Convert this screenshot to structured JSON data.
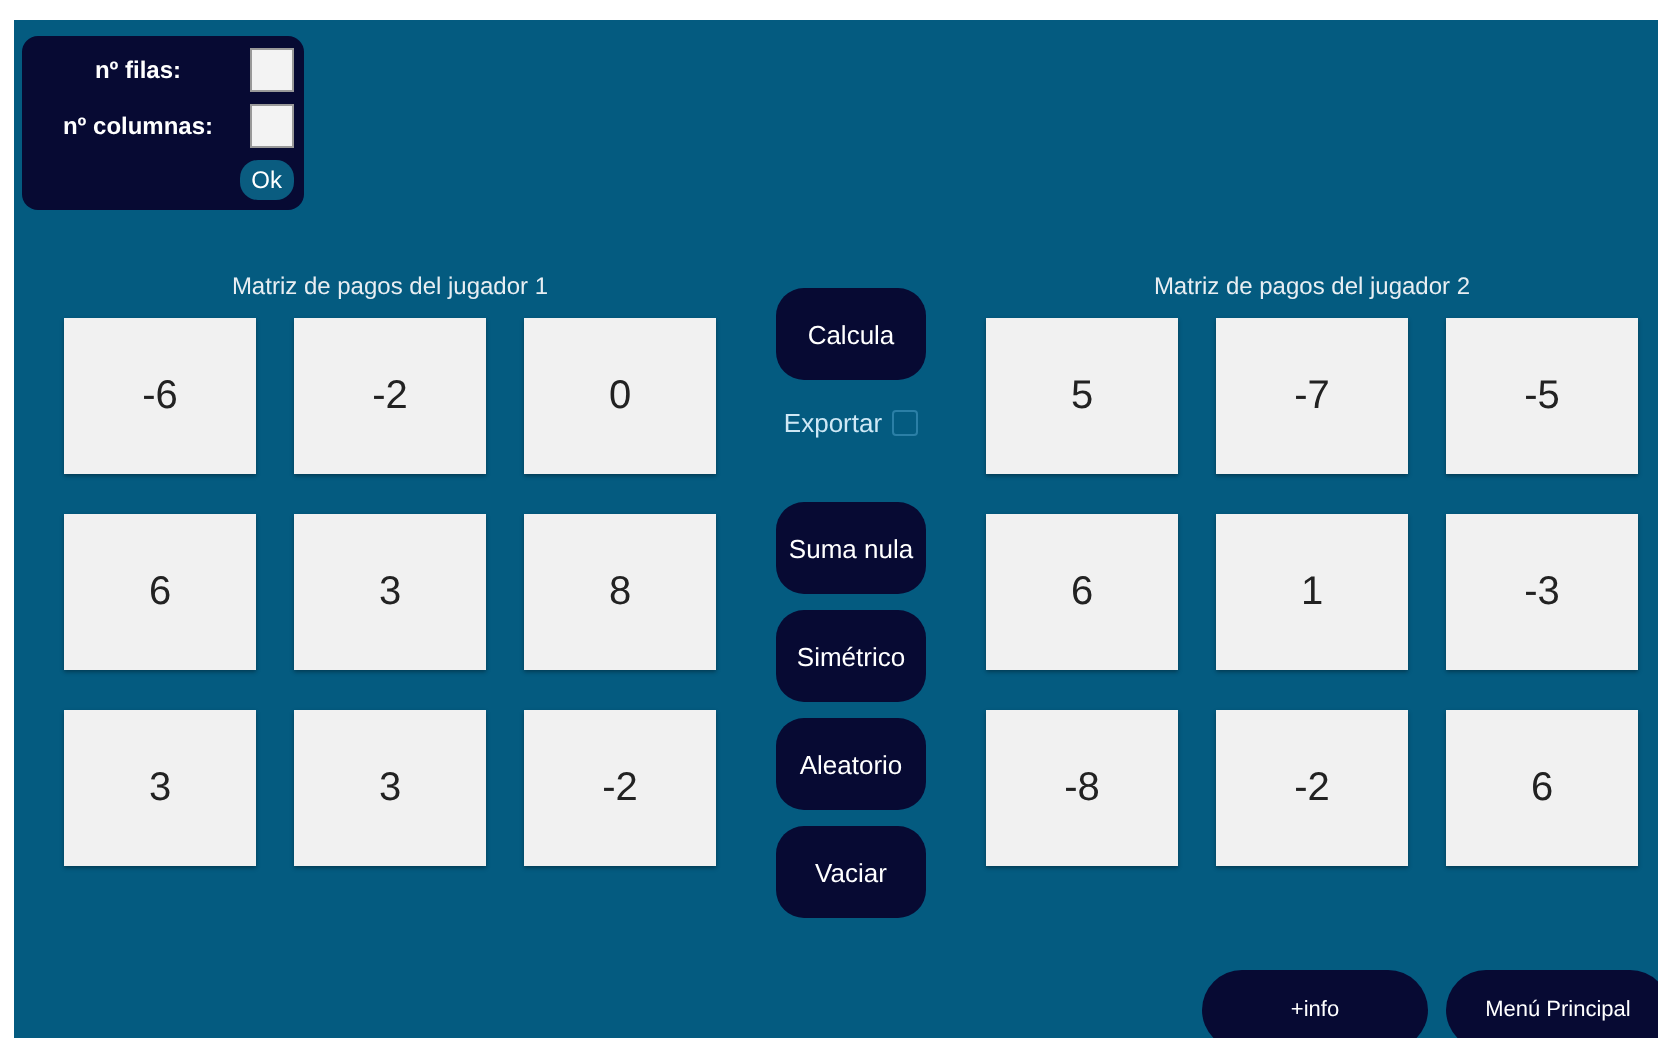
{
  "settings": {
    "rows_label": "nº filas:",
    "columns_label": "nº columnas:",
    "ok": "Ok"
  },
  "player1": {
    "title": "Matriz de pagos del jugador 1",
    "cells": [
      [
        "-6",
        "-2",
        "0"
      ],
      [
        "6",
        "3",
        "8"
      ],
      [
        "3",
        "3",
        "-2"
      ]
    ]
  },
  "player2": {
    "title": "Matriz de pagos del jugador 2",
    "cells": [
      [
        "5",
        "-7",
        "-5"
      ],
      [
        "6",
        "1",
        "-3"
      ],
      [
        "-8",
        "-2",
        "6"
      ]
    ]
  },
  "actions": {
    "calculate": "Calcula",
    "export": {
      "label": "Exportar",
      "checked": false
    },
    "buttons": [
      "Suma nula",
      "Simétrico",
      "Aleatorio",
      "Vaciar"
    ]
  },
  "footer": [
    "+info",
    "Menú Principal"
  ]
}
